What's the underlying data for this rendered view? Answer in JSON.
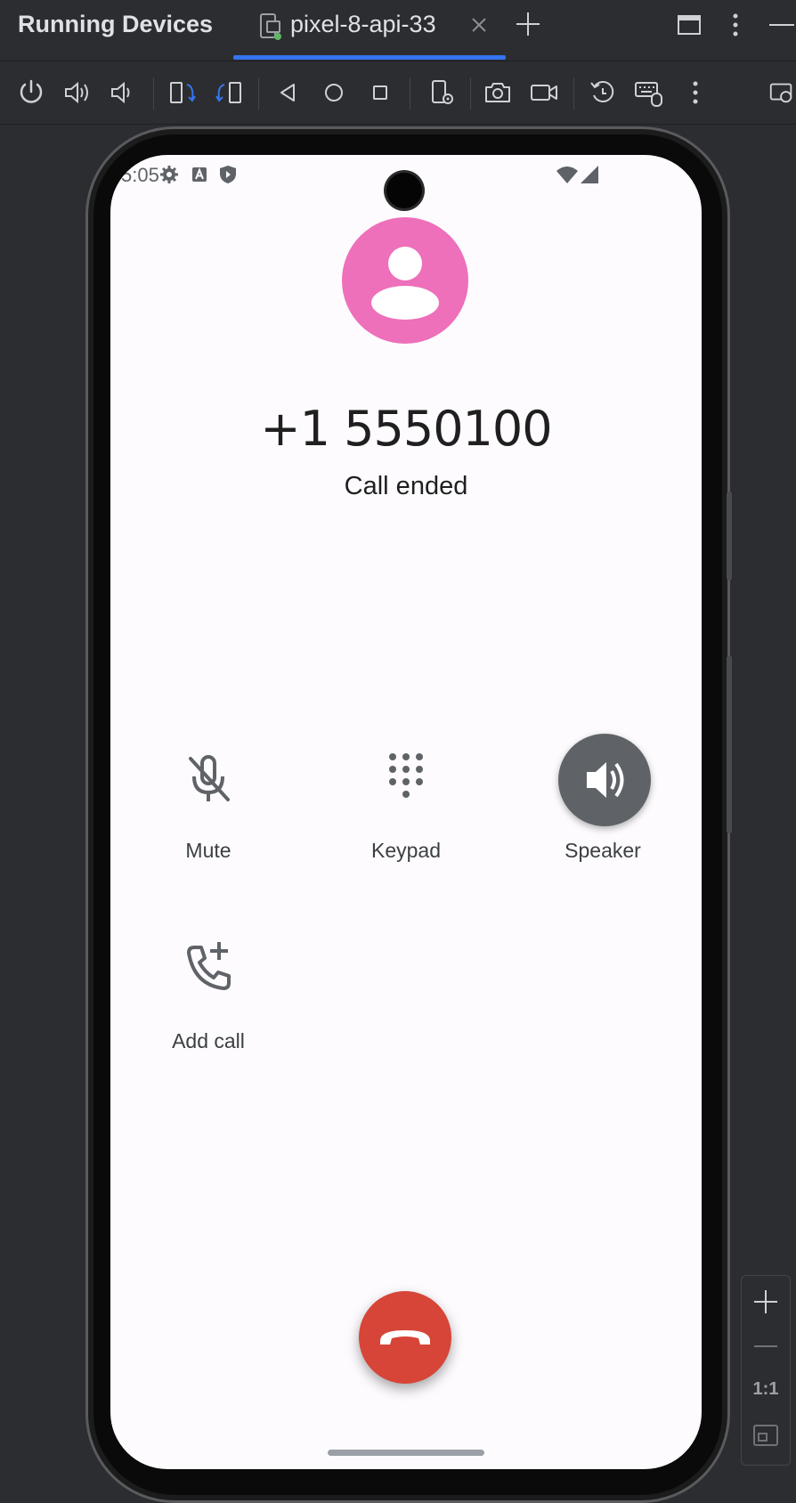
{
  "window": {
    "title": "Running Devices",
    "tab_label": "pixel-8-api-33"
  },
  "colors": {
    "accent": "#3574f0",
    "avatar": "#ee6fba",
    "end_call": "#d64537",
    "speaker_active": "#5f6368"
  },
  "toolbar": {
    "buttons": [
      "power-icon",
      "volume-up-icon",
      "volume-down-icon",
      "rotate-left-icon",
      "rotate-right-icon",
      "back-icon",
      "home-icon",
      "overview-icon",
      "device-settings-icon",
      "screenshot-icon",
      "screen-record-icon",
      "reset-icon",
      "keyboard-mouse-icon",
      "more-icon",
      "device-mirror-icon"
    ]
  },
  "phone": {
    "status_bar": {
      "time": "5:05"
    },
    "call": {
      "number": "+1 5550100",
      "status": "Call ended"
    },
    "actions": [
      {
        "label": "Mute",
        "icon": "mic-off-icon"
      },
      {
        "label": "Keypad",
        "icon": "dialpad-icon"
      },
      {
        "label": "Speaker",
        "icon": "speaker-icon",
        "active": true
      },
      {
        "label": "Add call",
        "icon": "add-call-icon"
      }
    ]
  },
  "zoom": {
    "actual_size_label": "1:1"
  }
}
